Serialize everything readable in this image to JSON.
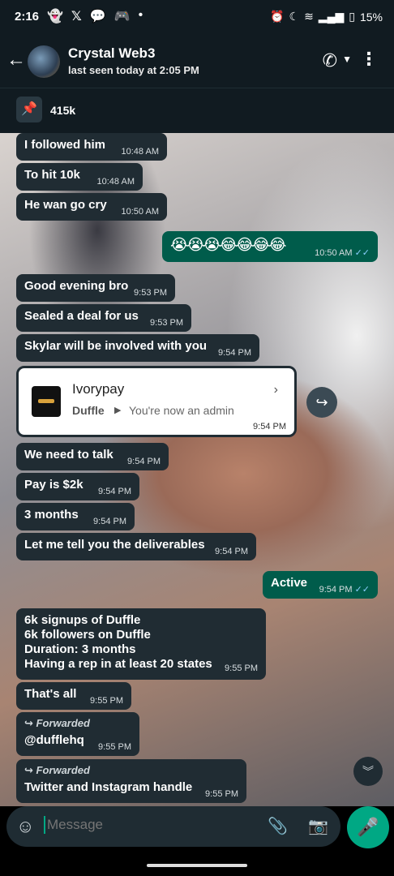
{
  "status_bar": {
    "time": "2:16",
    "left_icons": [
      "snapchat-icon",
      "x-icon",
      "chat-icon",
      "discord-icon",
      "dot-icon"
    ],
    "battery": "15%"
  },
  "header": {
    "contact_name": "Crystal Web3",
    "last_seen": "last seen today at 2:05 PM"
  },
  "pinned": {
    "count": "415k"
  },
  "messages": [
    {
      "text": "I followed him",
      "time": "10:48 AM"
    },
    {
      "text": "To hit 10k",
      "time": "10:48 AM"
    },
    {
      "text": "He wan go cry",
      "time": "10:50 AM"
    },
    {
      "text": "😭😭😭😂😂😂😂",
      "time": "10:50 AM"
    },
    {
      "text": "Good evening bro",
      "time": "9:53 PM"
    },
    {
      "text": "Sealed a deal for us",
      "time": "9:53 PM"
    },
    {
      "text": "Skylar will be involved with you",
      "time": "9:54 PM"
    },
    {
      "card": {
        "title": "Ivorypay",
        "sub1": "Duffle",
        "sub2": "You're now an admin"
      },
      "time": "9:54 PM"
    },
    {
      "text": "We need to talk",
      "time": "9:54 PM"
    },
    {
      "text": "Pay is $2k",
      "time": "9:54 PM"
    },
    {
      "text": "3 months",
      "time": "9:54 PM"
    },
    {
      "text": "Let me tell you the deliverables",
      "time": "9:54 PM"
    },
    {
      "text": "Active",
      "time": "9:54 PM"
    },
    {
      "lines": [
        "6k signups of Duffle",
        "6k followers on Duffle",
        "Duration: 3 months",
        "Having a rep in at least 20 states"
      ],
      "time": "9:55 PM"
    },
    {
      "text": "That's all",
      "time": "9:55 PM"
    },
    {
      "forwarded": "Forwarded",
      "text": "@dufflehq",
      "time": "9:55 PM"
    },
    {
      "forwarded": "Forwarded",
      "text": "Twitter and Instagram handle",
      "time": "9:55 PM"
    }
  ],
  "composer": {
    "placeholder": "Message"
  },
  "colors": {
    "incoming": "#202c33",
    "outgoing": "#005c4b",
    "accent": "#00a884",
    "read_ticks": "#8bd0ff"
  }
}
